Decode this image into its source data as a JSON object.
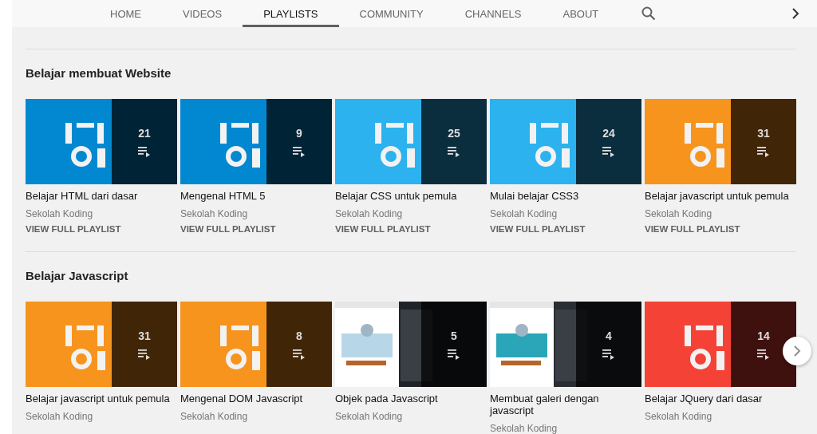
{
  "tabs": [
    {
      "label": "HOME",
      "selected": false
    },
    {
      "label": "VIDEOS",
      "selected": false
    },
    {
      "label": "PLAYLISTS",
      "selected": true
    },
    {
      "label": "COMMUNITY",
      "selected": false
    },
    {
      "label": "CHANNELS",
      "selected": false
    },
    {
      "label": "ABOUT",
      "selected": false
    }
  ],
  "sections": [
    {
      "title": "Belajar membuat Website",
      "playlists": [
        {
          "title": "Belajar HTML dari dasar",
          "channel": "Sekolah Koding",
          "count": "21",
          "action": "VIEW FULL PLAYLIST"
        },
        {
          "title": "Mengenal HTML 5",
          "channel": "Sekolah Koding",
          "count": "9",
          "action": "VIEW FULL PLAYLIST"
        },
        {
          "title": "Belajar CSS untuk pemula",
          "channel": "Sekolah Koding",
          "count": "25",
          "action": "VIEW FULL PLAYLIST"
        },
        {
          "title": "Mulai belajar CSS3",
          "channel": "Sekolah Koding",
          "count": "24",
          "action": "VIEW FULL PLAYLIST"
        },
        {
          "title": "Belajar javascript untuk pemula",
          "channel": "Sekolah Koding",
          "count": "31",
          "action": "VIEW FULL PLAYLIST"
        }
      ]
    },
    {
      "title": "Belajar Javascript",
      "playlists": [
        {
          "title": "Belajar javascript untuk pemula",
          "channel": "Sekolah Koding",
          "count": "31"
        },
        {
          "title": "Mengenal DOM Javascript",
          "channel": "Sekolah Koding",
          "count": "8"
        },
        {
          "title": "Objek pada Javascript",
          "channel": "Sekolah Koding",
          "count": "5"
        },
        {
          "title": "Membuat galeri dengan javascript",
          "channel": "Sekolah Koding",
          "count": "4"
        },
        {
          "title": "Belajar JQuery dari dasar",
          "channel": "Sekolah Koding",
          "count": "14"
        }
      ]
    }
  ]
}
